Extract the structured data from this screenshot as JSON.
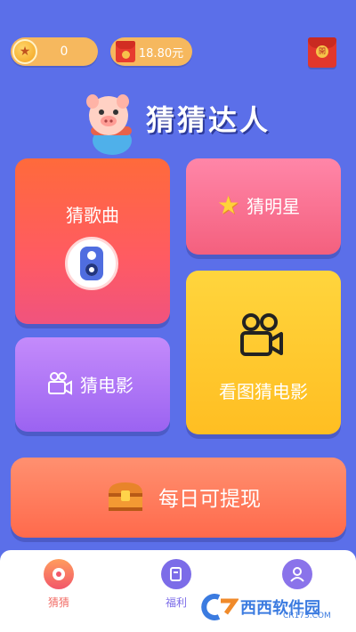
{
  "topbar": {
    "coins": "0",
    "money": "18.80元",
    "open_env_label": "開"
  },
  "logo": {
    "title": "猜猜达人"
  },
  "cards": {
    "song": "猜歌曲",
    "star": "猜明星",
    "movie": "猜电影",
    "pic_movie": "看图猜电影",
    "cash": "每日可提现"
  },
  "nav": {
    "guess": "猜猜",
    "welfare": "福利",
    "me": ""
  },
  "watermark": {
    "text": "西西软件园",
    "sub": "CR173.COM"
  },
  "colors": {
    "background": "#5b6fe9",
    "accent": "#f6b85e"
  }
}
